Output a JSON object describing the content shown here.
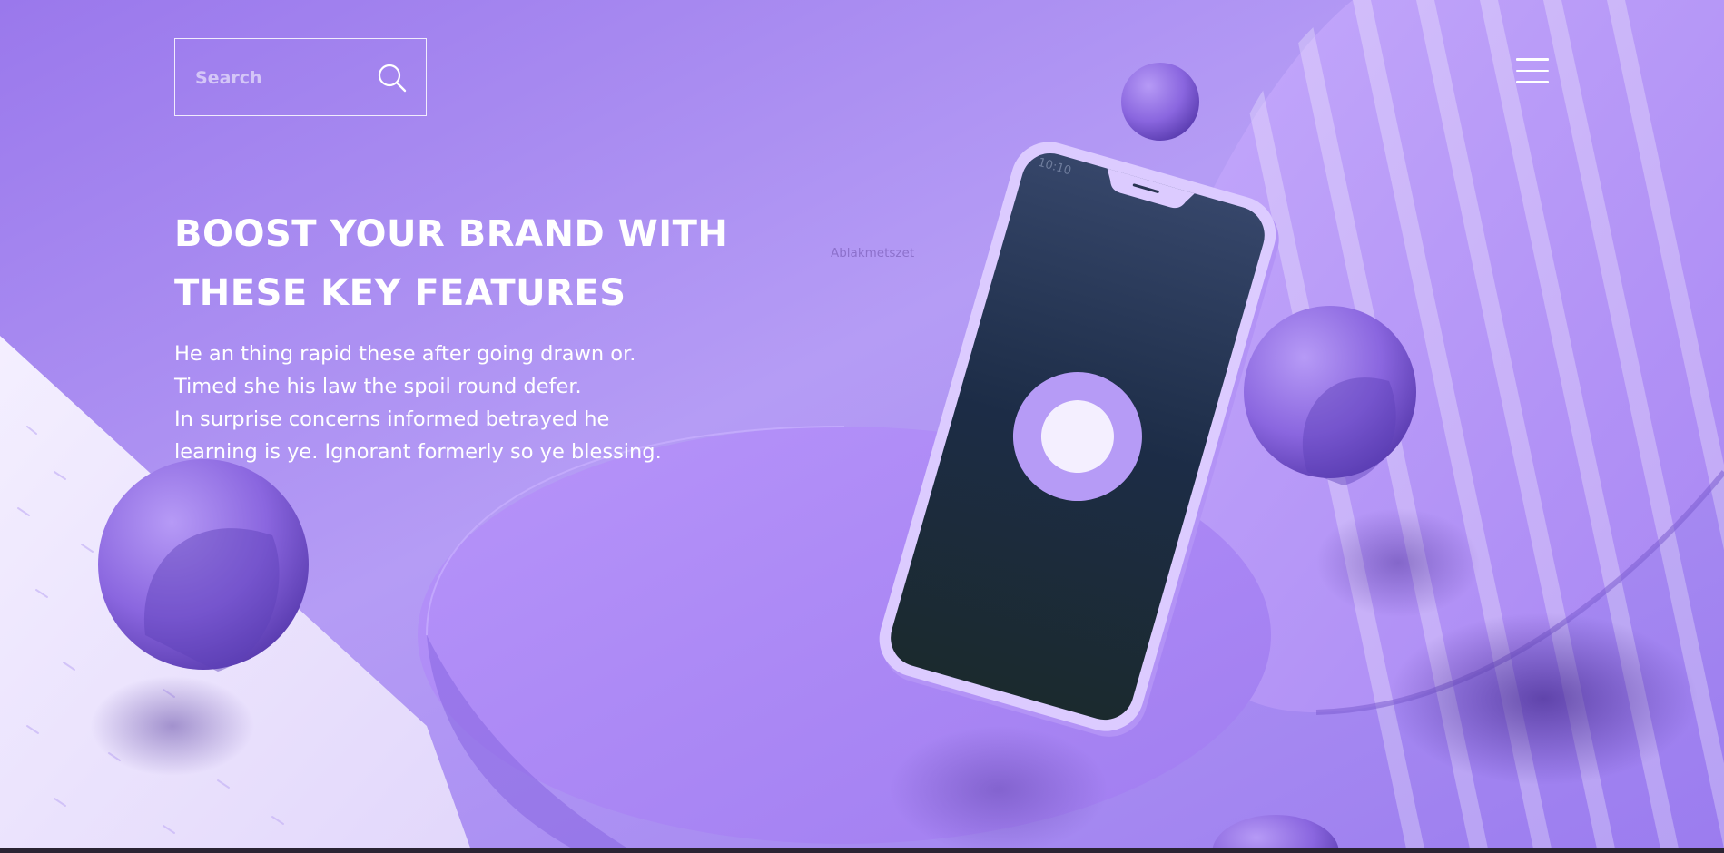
{
  "search": {
    "placeholder": "Search",
    "icon": "search-icon"
  },
  "menu": {
    "icon": "hamburger-menu-icon"
  },
  "hero": {
    "headline_line1": "BOOST YOUR BRAND WITH",
    "headline_line2": "THESE KEY FEATURES",
    "body_lines": [
      "He an thing rapid these after going drawn or.",
      "Timed she his law the spoil round defer.",
      "In surprise concerns informed betrayed he",
      "learning is ye. Ignorant formerly so ye blessing."
    ]
  },
  "phone": {
    "time": "10:10"
  },
  "watermark": "Ablakmetszet",
  "colors": {
    "background": "#a98bf0",
    "accent_light": "#c6a9ff",
    "accent_dark": "#5a3fb5",
    "phone_screen": "#1c2a3e",
    "text": "#ffffff"
  }
}
